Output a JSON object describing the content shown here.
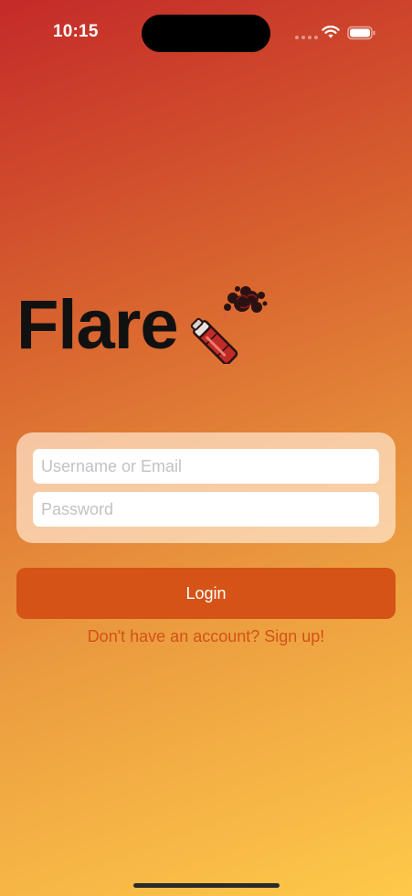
{
  "status_bar": {
    "time": "10:15",
    "icons": [
      "signal-icon",
      "wifi-icon",
      "battery-icon"
    ]
  },
  "app": {
    "title": "Flare",
    "logo_icon": "flare-stick-icon"
  },
  "form": {
    "username_placeholder": "Username or Email",
    "password_placeholder": "Password",
    "username_value": "",
    "password_value": ""
  },
  "actions": {
    "login_label": "Login",
    "signup_text": "Don't have an account? Sign up!"
  },
  "colors": {
    "gradient_top": "#c42a29",
    "gradient_bottom": "#fec94a",
    "accent": "#d55316",
    "card": "#fde4cc",
    "link": "#d2521a"
  }
}
